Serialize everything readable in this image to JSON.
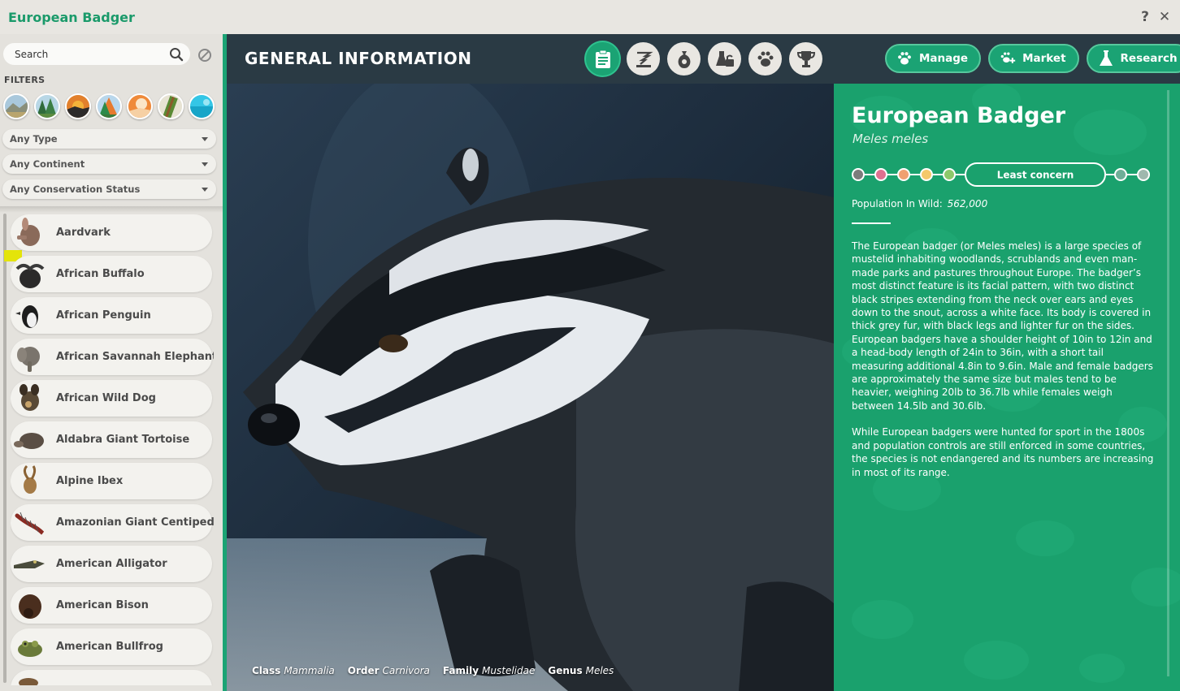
{
  "window": {
    "title": "European Badger",
    "help_label": "?",
    "close_label": "✕"
  },
  "sidebar": {
    "search_placeholder": "Search",
    "filters_label": "FILTERS",
    "biome_icons": [
      "grassland-biome-icon",
      "temperate-biome-icon",
      "desert-biome-icon",
      "tropical-biome-icon",
      "tundra-biome-icon",
      "taiga-biome-icon",
      "aquatic-biome-icon"
    ],
    "dropdowns": {
      "type": "Any Type",
      "continent": "Any Continent",
      "conservation": "Any Conservation Status"
    },
    "animals": [
      "Aardvark",
      "African Buffalo",
      "African Penguin",
      "African Savannah Elephant",
      "African Wild Dog",
      "Aldabra Giant Tortoise",
      "Alpine Ibex",
      "Amazonian Giant Centipede",
      "American Alligator",
      "American Bison",
      "American Bullfrog",
      ""
    ]
  },
  "header": {
    "section_title": "GENERAL INFORMATION",
    "tabs": [
      "general-info-icon",
      "habitat-icon",
      "enrichment-icon",
      "welfare-icon",
      "behaviour-icon",
      "trophy-icon"
    ],
    "buttons": {
      "manage": "Manage",
      "market": "Market",
      "research": "Research"
    }
  },
  "taxonomy": {
    "class_label": "Class",
    "class_value": "Mammalia",
    "order_label": "Order",
    "order_value": "Carnivora",
    "family_label": "Family",
    "family_value": "Mustelidae",
    "genus_label": "Genus",
    "genus_value": "Meles"
  },
  "info": {
    "name": "European Badger",
    "scientific_name": "Meles meles",
    "status_label": "Least concern",
    "status_colors": [
      "#7c7c7c",
      "#e07090",
      "#f0a070",
      "#f4c86a",
      "#8cc86a",
      "#1aa16d",
      "#6fae98",
      "#9fb8ae"
    ],
    "population_label": "Population In Wild:",
    "population_value": "562,000",
    "description_1": "The European badger (or Meles meles) is a large species of mustelid inhabiting woodlands, scrublands and even man-made parks and pastures throughout Europe. The badger’s most distinct feature is its facial pattern, with two distinct black stripes extending from the neck over ears and eyes down to the snout, across a white face. Its body is covered in thick grey fur, with black legs and lighter fur on the sides. European badgers have a shoulder height of 10in to 12in and a head-body length of 24in to 36in, with a short tail measuring additional 4.8in to 9.6in. Male and female badgers are approximately the same size but males tend to be heavier, weighing 20lb to 36.7lb while females weigh between 14.5lb and 30.6lb.",
    "description_2": "While European badgers were hunted for sport in the 1800s and population controls are still enforced in some countries, the species is not endangered and its numbers are increasing in most of its range."
  }
}
